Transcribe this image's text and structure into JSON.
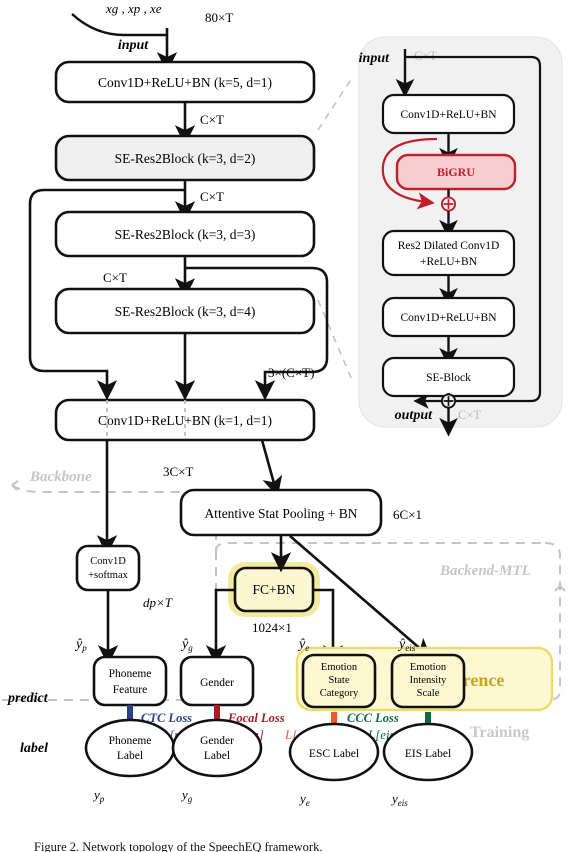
{
  "figure": {
    "caption": "Figure 2. Network topology of the SpeechEQ framework.",
    "input_signal": "xg , xp , xe",
    "input_label": "input"
  },
  "backbone": {
    "region_label": "Backbone",
    "blocks": [
      {
        "id": "conv1",
        "label": "Conv1D+ReLU+BN (k=5, d=1)",
        "fill": "#ffffff"
      },
      {
        "id": "se1",
        "label": "SE-Res2Block (k=3, d=2)",
        "fill": "#f0f0f0"
      },
      {
        "id": "se2",
        "label": "SE-Res2Block (k=3, d=3)",
        "fill": "#ffffff"
      },
      {
        "id": "se3",
        "label": "SE-Res2Block (k=3, d=4)",
        "fill": "#ffffff"
      },
      {
        "id": "conv2",
        "label": "Conv1D+ReLU+BN (k=1, d=1)",
        "fill": "#ffffff"
      }
    ],
    "dims": {
      "input_dim": "80×T",
      "after_conv1": "C×T",
      "after_se1": "C×T",
      "after_se2": "C×T",
      "concat": "3×(C×T)",
      "after_conv2": "3C×T"
    }
  },
  "detail_panel": {
    "input_label": "input",
    "input_dim": "C×T",
    "output_label": "output",
    "output_dim": "C×T",
    "blocks": [
      {
        "id": "d_conv_a",
        "label": "Conv1D+ReLU+BN"
      },
      {
        "id": "d_bigru",
        "label": "BiGRU"
      },
      {
        "id": "d_res2",
        "label_line1": "Res2 Dilated Conv1D",
        "label_line2": "+ReLU+BN"
      },
      {
        "id": "d_conv_b",
        "label": "Conv1D+ReLU+BN"
      },
      {
        "id": "d_se",
        "label": "SE-Block"
      }
    ],
    "bigru_fill": "#f8cdd0",
    "bigru_stroke": "#c0202a",
    "panel_fill": "#f1f1f1"
  },
  "backend": {
    "region_label": "Backend-MTL",
    "pooling_label": "Attentive Stat Pooling + BN",
    "pooling_dim": "6C×1",
    "phoneme_head_line1": "Conv1D",
    "phoneme_head_line2": "+softmax",
    "phoneme_dim": "dp×T",
    "fc_label": "FC+BN",
    "fc_dim": "1024×1",
    "inference_label": "Inference",
    "training_label": "Training",
    "fc_fill": "#fcf7d0",
    "inference_fill": "#fdf8d2",
    "inference_stroke": "#e8dc6a"
  },
  "predict": {
    "row_label": "predict",
    "items": [
      {
        "id": "phoneme_feature",
        "line1": "Phoneme",
        "line2": "Feature",
        "var": "ŷp"
      },
      {
        "id": "gender",
        "line1": "Gender",
        "line2": "",
        "var": "ŷg"
      },
      {
        "id": "esc",
        "line1": "Emotion",
        "line2": "State",
        "line3": "Category",
        "var": "ŷe"
      },
      {
        "id": "eis",
        "line1": "Emotion",
        "line2": "Intensity",
        "line3": "Scale",
        "var": "ŷeis"
      }
    ]
  },
  "label": {
    "row_label": "label",
    "items": [
      {
        "id": "phoneme_label",
        "line1": "Phoneme",
        "line2": "Label",
        "var": "yp"
      },
      {
        "id": "gender_label",
        "line1": "Gender",
        "line2": "Label",
        "var": "yg"
      },
      {
        "id": "esc_label",
        "line1": "ESC Label",
        "line2": "",
        "var": "ye"
      },
      {
        "id": "eis_label",
        "line1": "EIS Label",
        "line2": "",
        "var": "yeis"
      }
    ]
  },
  "losses": [
    {
      "id": "ctc",
      "name": "CTC Loss",
      "symbol": "L[p]",
      "color": "#2b3f8c"
    },
    {
      "id": "focal_g",
      "name": "Focal Loss",
      "symbol": "L[g]",
      "color": "#a51f23"
    },
    {
      "id": "focal_e",
      "name": "",
      "symbol": "L[e]",
      "color": "#f15a29"
    },
    {
      "id": "ccc",
      "name": "CCC Loss",
      "symbol": "L[eis]",
      "color": "#0d6b3f"
    }
  ],
  "colors": {
    "box_stroke": "#111111",
    "dashed_gray": "#c4c4c4",
    "ghost_text": "#c6c6c6"
  }
}
